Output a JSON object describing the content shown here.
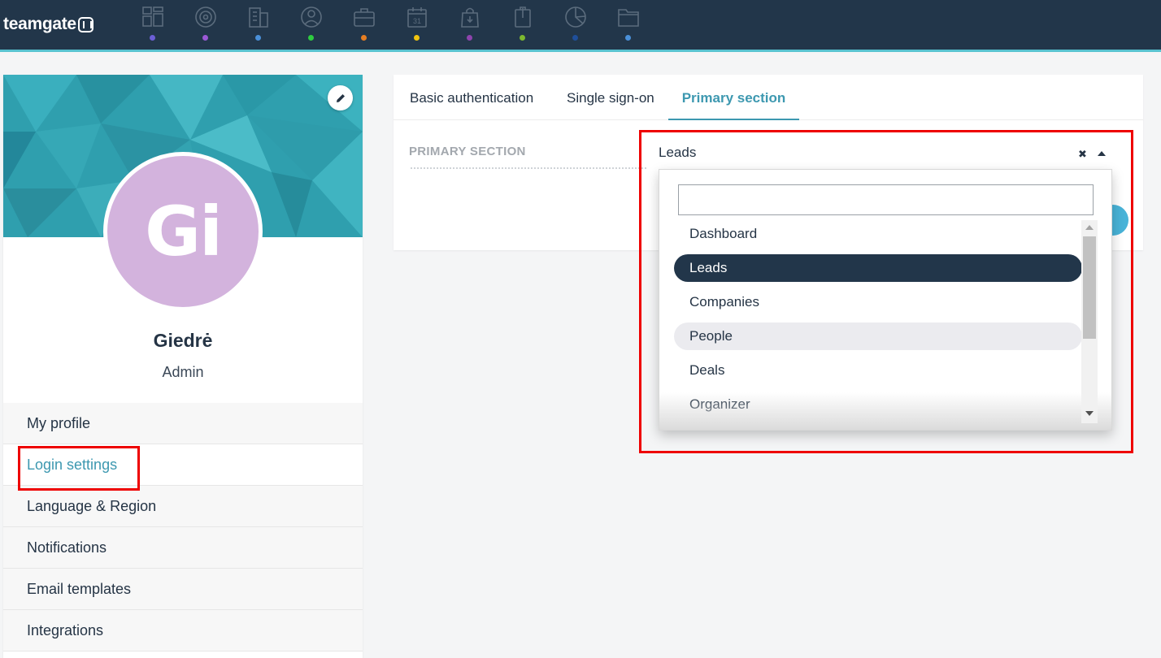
{
  "app": {
    "logo_text": "teamgate",
    "nav": [
      {
        "icon": "dashboard-icon",
        "dot_color": "#6c5fd6"
      },
      {
        "icon": "target-icon",
        "dot_color": "#9b59d6"
      },
      {
        "icon": "companies-icon",
        "dot_color": "#4a90d9"
      },
      {
        "icon": "person-icon",
        "dot_color": "#2ecc40"
      },
      {
        "icon": "briefcase-icon",
        "dot_color": "#e67e22"
      },
      {
        "icon": "calendar-icon",
        "dot_color": "#f1c40f",
        "label": "31"
      },
      {
        "icon": "shopping-bag-icon",
        "dot_color": "#8e44ad"
      },
      {
        "icon": "clipboard-icon",
        "dot_color": "#7cb82f"
      },
      {
        "icon": "pie-chart-icon",
        "dot_color": "#1f4f9a"
      },
      {
        "icon": "folder-icon",
        "dot_color": "#4a90d9"
      }
    ]
  },
  "profile": {
    "initials": "Gi",
    "name": "Giedrė",
    "role": "Admin",
    "avatar_color": "#d3b3dd",
    "menu": [
      {
        "label": "My profile"
      },
      {
        "label": "Login settings",
        "active": true
      },
      {
        "label": "Language & Region"
      },
      {
        "label": "Notifications"
      },
      {
        "label": "Email templates"
      },
      {
        "label": "Integrations"
      }
    ]
  },
  "settings": {
    "tabs": [
      {
        "label": "Basic authentication"
      },
      {
        "label": "Single sign-on"
      },
      {
        "label": "Primary section",
        "active": true
      }
    ],
    "field_label": "PRIMARY SECTION",
    "select": {
      "value": "Leads",
      "search_value": "",
      "options": [
        "Dashboard",
        "Leads",
        "Companies",
        "People",
        "Deals",
        "Organizer"
      ],
      "selected": "Leads",
      "hovered": "People"
    }
  },
  "colors": {
    "topbar": "#22364a",
    "accent": "#3d98b0",
    "highlight": "#ee0000"
  }
}
